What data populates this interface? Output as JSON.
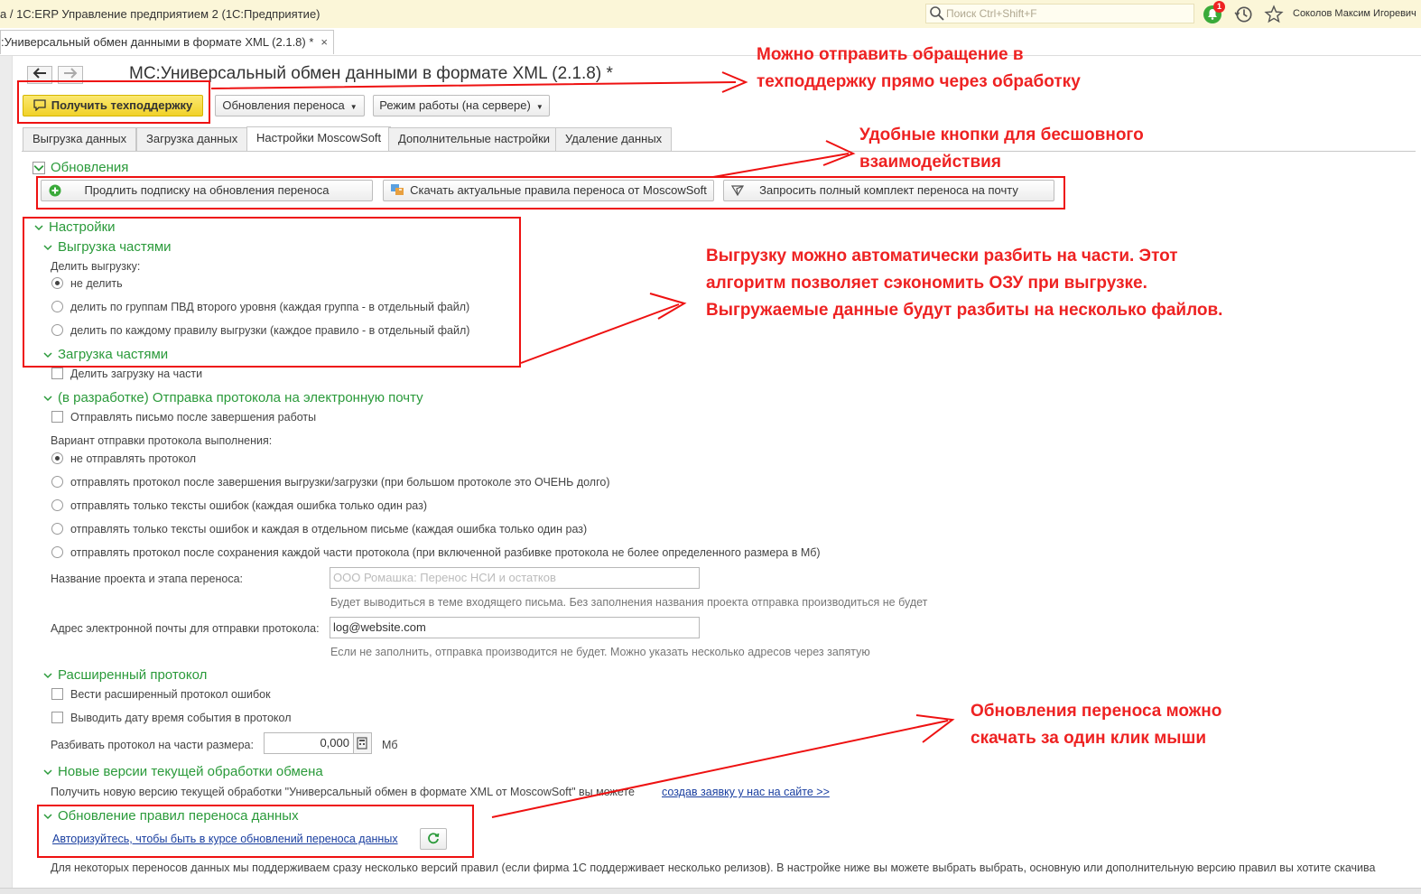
{
  "app": {
    "window_title": "а / 1С:ERP Управление предприятием 2  (1С:Предприятие)",
    "search_placeholder": "Поиск Ctrl+Shift+F",
    "notification_count": "1",
    "user_name": "Соколов Максим Игоревич",
    "doc_tab": ":Универсальный обмен данными в формате XML (2.1.8) *",
    "doc_tab_close": "×"
  },
  "header": {
    "title": "МС:Универсальный обмен данными в формате XML (2.1.8) *",
    "back_icon": "arrow-left-icon",
    "forward_icon": "arrow-right-icon"
  },
  "toolbar": {
    "support_label": "Получить техподдержку",
    "updates_label": "Обновления переноса",
    "mode_label": "Режим работы (на сервере)"
  },
  "tabs": [
    {
      "label": "Выгрузка данных"
    },
    {
      "label": "Загрузка данных"
    },
    {
      "label": "Настройки MoscowSoft"
    },
    {
      "label": "Дополнительные настройки"
    },
    {
      "label": "Удаление данных"
    }
  ],
  "updates_group": {
    "title": "Обновления",
    "btn_extend": "Продлить подписку на обновления переноса",
    "btn_download": "Скачать актуальные правила переноса от MoscowSoft",
    "btn_request": "Запросить полный комплект переноса на почту"
  },
  "settings": {
    "title": "Настройки",
    "export_parts": {
      "title": "Выгрузка частями",
      "label": "Делить выгрузку:",
      "options": [
        "не делить",
        "делить по группам ПВД второго уровня (каждая группа - в отдельный файл)",
        "делить по каждому правилу выгрузки (каждое правило - в отдельный файл)"
      ],
      "selected": 0
    },
    "import_parts": {
      "title": "Загрузка частями",
      "checkbox": "Делить загрузку на части"
    },
    "email_protocol": {
      "title": "(в разработке) Отправка протокола на электронную почту",
      "checkbox": "Отправлять письмо после завершения работы",
      "variant_label": "Вариант отправки протокола выполнения:",
      "options": [
        "не отправлять протокол",
        "отправлять протокол после завершения выгрузки/загрузки (при большом протоколе это ОЧЕНЬ долго)",
        "отправлять только тексты ошибок (каждая ошибка только один раз)",
        "отправлять только тексты ошибок и каждая в отдельном письме (каждая ошибка только один раз)",
        "отправлять протокол после сохранения каждой части протокола (при включенной разбивке протокола не более определенного размера в Мб)"
      ],
      "selected": 0,
      "project_label": "Название проекта и этапа переноса:",
      "project_placeholder": "ООО Ромашка: Перенос НСИ и остатков",
      "project_hint": "Будет выводиться в теме входящего письма. Без заполнения названия проекта отправка производиться не будет",
      "email_label": "Адрес электронной почты для отправки протокола:",
      "email_value": "log@website.com",
      "email_hint": "Если не заполнить, отправка производится не будет. Можно указать несколько адресов через запятую"
    },
    "extended_protocol": {
      "title": "Расширенный протокол",
      "checkbox1": "Вести расширенный протокол ошибок",
      "checkbox2": "Выводить дату время события в протокол",
      "split_label": "Разбивать протокол на части размера:",
      "split_value": "0,000",
      "split_unit": "Мб"
    },
    "new_versions": {
      "title": "Новые версии текущей обработки обмена",
      "text": "Получить новую версию текущей обработки \"Универсальный обмен в формате XML от MoscowSoft\" вы можете",
      "link": "создав заявку у нас на сайте >>"
    },
    "rules_update": {
      "title": "Обновление правил переноса данных",
      "link": "Авторизуйтесь, чтобы быть в курсе обновлений переноса данных",
      "note": "Для некоторых переносов данных мы поддерживаем сразу несколько версий правил (если фирма 1С поддерживает несколько релизов). В настройке ниже вы можете выбрать выбрать, основную или дополнительную версию правил вы хотите скачива"
    }
  },
  "annotations": {
    "a1": [
      "Можно отправить обращение в",
      "техподдержку прямо через обработку"
    ],
    "a2": [
      "Удобные кнопки для бесшовного",
      "взаимодействия"
    ],
    "a3": [
      "Выгрузку можно автоматически разбить на части. Этот",
      "алгоритм позволяет сэкономить ОЗУ при выгрузке.",
      "Выгружаемые данные будут разбиты на несколько файлов."
    ],
    "a4": [
      "Обновления переноса можно",
      "скачать за один клик мыши"
    ]
  },
  "colors": {
    "accent_green": "#2a9a3a",
    "annotation_red": "#e11",
    "support_yellow": "#f1d229",
    "titlebar": "#fbf6d8",
    "link_blue": "#1a3fa0"
  }
}
